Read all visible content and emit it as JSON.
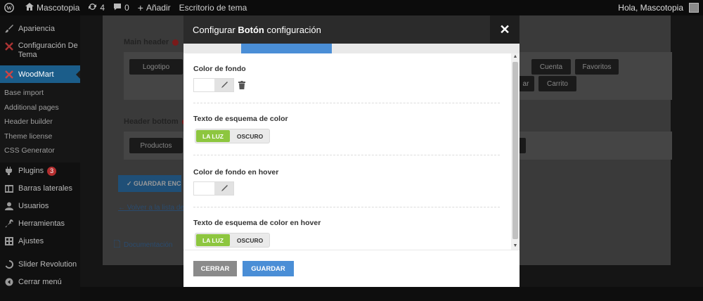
{
  "adminbar": {
    "site_name": "Mascotopia",
    "updates_count": "4",
    "comments_count": "0",
    "add_new": "Añadir",
    "theme_desk": "Escritorio de tema",
    "greeting": "Hola, Mascotopia"
  },
  "sidebar": {
    "items": [
      {
        "label": "Apariencia",
        "icon": "paintbrush-icon"
      },
      {
        "label": "Configuración De Tema",
        "icon": "theme-settings-icon"
      },
      {
        "label": "WoodMart",
        "icon": "woodmart-icon"
      }
    ],
    "submenu": [
      "Base import",
      "Additional pages",
      "Header builder",
      "Theme license",
      "CSS Generator"
    ],
    "items2": [
      {
        "label": "Plugins",
        "icon": "plugins-icon",
        "badge": "3"
      },
      {
        "label": "Barras laterales",
        "icon": "sidebars-icon"
      },
      {
        "label": "Usuarios",
        "icon": "users-icon"
      },
      {
        "label": "Herramientas",
        "icon": "tools-icon"
      },
      {
        "label": "Ajustes",
        "icon": "settings-icon"
      },
      {
        "label": "Slider Revolution",
        "icon": "slider-icon"
      },
      {
        "label": "Cerrar menú",
        "icon": "collapse-icon"
      }
    ]
  },
  "background": {
    "main_header": "Main header",
    "header_bottom": "Header bottom",
    "logo_btn": "Logotipo",
    "cuenta_btn": "Cuenta",
    "favoritos_btn": "Favoritos",
    "ar_btn": "ar",
    "carrito_btn": "Carrito",
    "productos_btn": "Productos",
    "save_header": "✓  GUARDAR ENC",
    "back_link": "← Volver a la lista de",
    "doc_link": "Documentación"
  },
  "modal": {
    "title_prefix": "Configurar ",
    "title_bold": "Botón",
    "title_suffix": " configuración",
    "fields": [
      {
        "label": "Color de fondo",
        "type": "color"
      },
      {
        "label": "Texto de esquema de color",
        "type": "toggle",
        "options": [
          "LA LUZ",
          "OSCURO"
        ],
        "selected": "LA LUZ"
      },
      {
        "label": "Color de fondo en hover",
        "type": "color"
      },
      {
        "label": "Texto de esquema de color en hover",
        "type": "toggle",
        "options": [
          "LA LUZ",
          "OSCURO"
        ],
        "selected": "LA LUZ"
      }
    ],
    "cancel": "CERRAR",
    "save": "GUARDAR"
  },
  "colors": {
    "accent_blue": "#4a8ed6",
    "toggle_green": "#8dc63f",
    "cancel_gray": "#8a8a8a"
  }
}
